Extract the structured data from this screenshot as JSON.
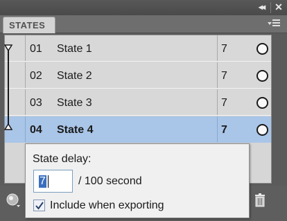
{
  "panel": {
    "tab_label": "STATES",
    "collapse_glyph": "◂◂",
    "close_glyph": "✕"
  },
  "states": [
    {
      "num": "01",
      "name": "State 1",
      "delay": "7",
      "selected": false
    },
    {
      "num": "02",
      "name": "State 2",
      "delay": "7",
      "selected": false
    },
    {
      "num": "03",
      "name": "State 3",
      "delay": "7",
      "selected": false
    },
    {
      "num": "04",
      "name": "State 4",
      "delay": "7",
      "selected": true
    }
  ],
  "delay_popup": {
    "label": "State delay:",
    "value": "7",
    "unit": "/ 100 second",
    "include_label": "Include when exporting",
    "include_checked": true
  },
  "colors": {
    "selection": "#a9c5e8",
    "panel_dark": "#5b5b5b",
    "row_bg": "#d8d8d8"
  },
  "icons": {
    "tween_start": "onion-skin-start-icon",
    "tween_end": "onion-skin-end-icon",
    "state_toggle": "circle-icon",
    "add_state": "add-state-icon",
    "delete": "trash-icon",
    "panel_menu": "panel-menu-icon"
  }
}
